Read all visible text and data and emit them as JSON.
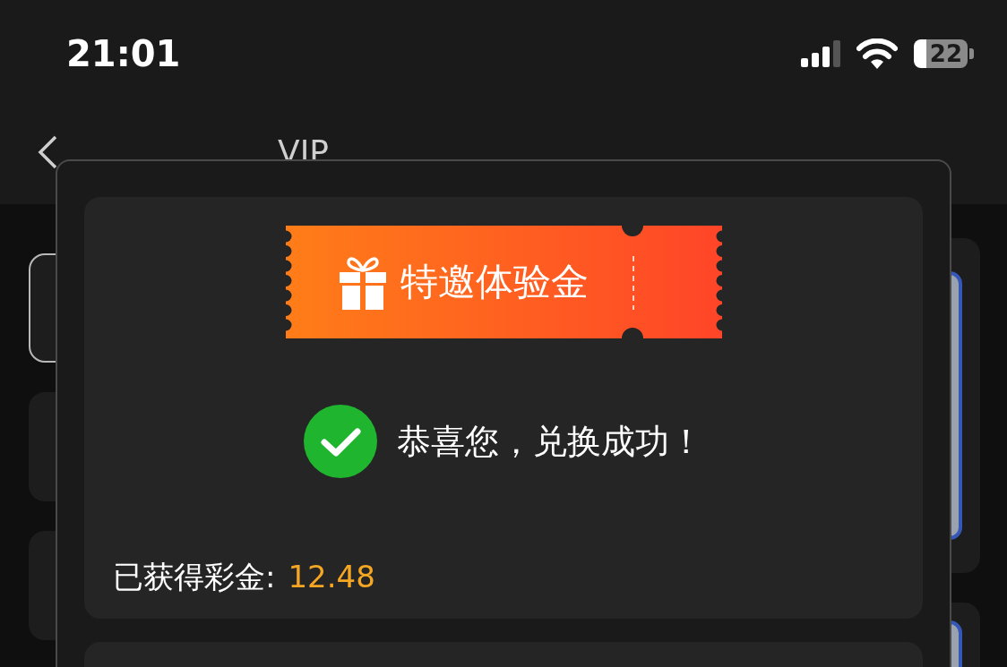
{
  "status_bar": {
    "time": "21:01",
    "battery": "22"
  },
  "nav": {
    "tabs": [
      {
        "label": "VIP"
      }
    ]
  },
  "modal": {
    "ticket": {
      "label": "特邀体验金"
    },
    "message": "恭喜您，兑换成功！",
    "reward": {
      "label": "已获得彩金:",
      "amount": "12.48"
    }
  }
}
